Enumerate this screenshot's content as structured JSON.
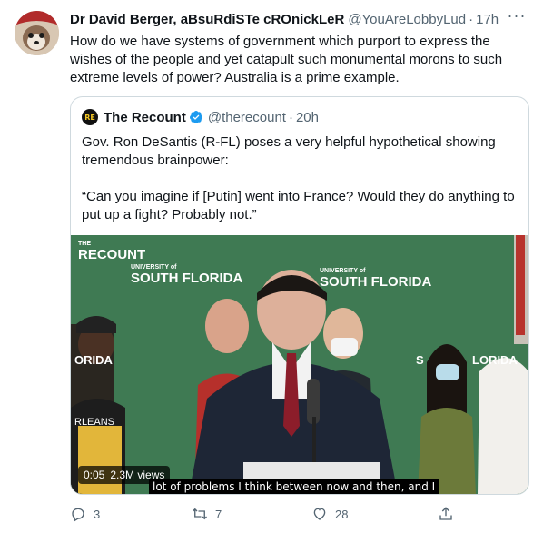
{
  "tweet": {
    "author_name": "Dr David Berger, aBsuRdiSTe cROnickLeR",
    "author_handle": "@YouAreLobbyLud",
    "time": "17h",
    "text": "How do we have systems of government which purport to express the wishes of the people and yet catapult such monumental morons to such extreme levels of power? Australia is a prime example."
  },
  "quote": {
    "logo_text": "RE",
    "author_name": "The Recount",
    "author_handle": "@therecount",
    "time": "20h",
    "paragraph_1": "Gov. Ron DeSantis (R-FL) poses a very helpful hypothetical showing tremendous brainpower:",
    "paragraph_2": "“Can you imagine if [Putin] went into France? Would they do anything to put up a fight? Probably not.”",
    "video": {
      "watermark": "RECOUNT",
      "watermark_prefix": "THE",
      "banner_small": "UNIVERSITY of",
      "banner_large": "SOUTH FLORIDA",
      "banner_left_partial": "ORIDA",
      "banner_right_partial": "LORIDA",
      "banner_right_s": "S",
      "banner_far_left": "RLEANS",
      "duration": "0:05",
      "views": "2.3M views",
      "caption": "lot of problems I think between now and then, and I"
    }
  },
  "actions": {
    "reply_count": "3",
    "retweet_count": "7",
    "like_count": "28"
  },
  "colors": {
    "text": "#0f1419",
    "muted": "#536471",
    "border": "#cfd9de",
    "verified": "#1d9bf0",
    "usf_green": "#3f7a53"
  }
}
